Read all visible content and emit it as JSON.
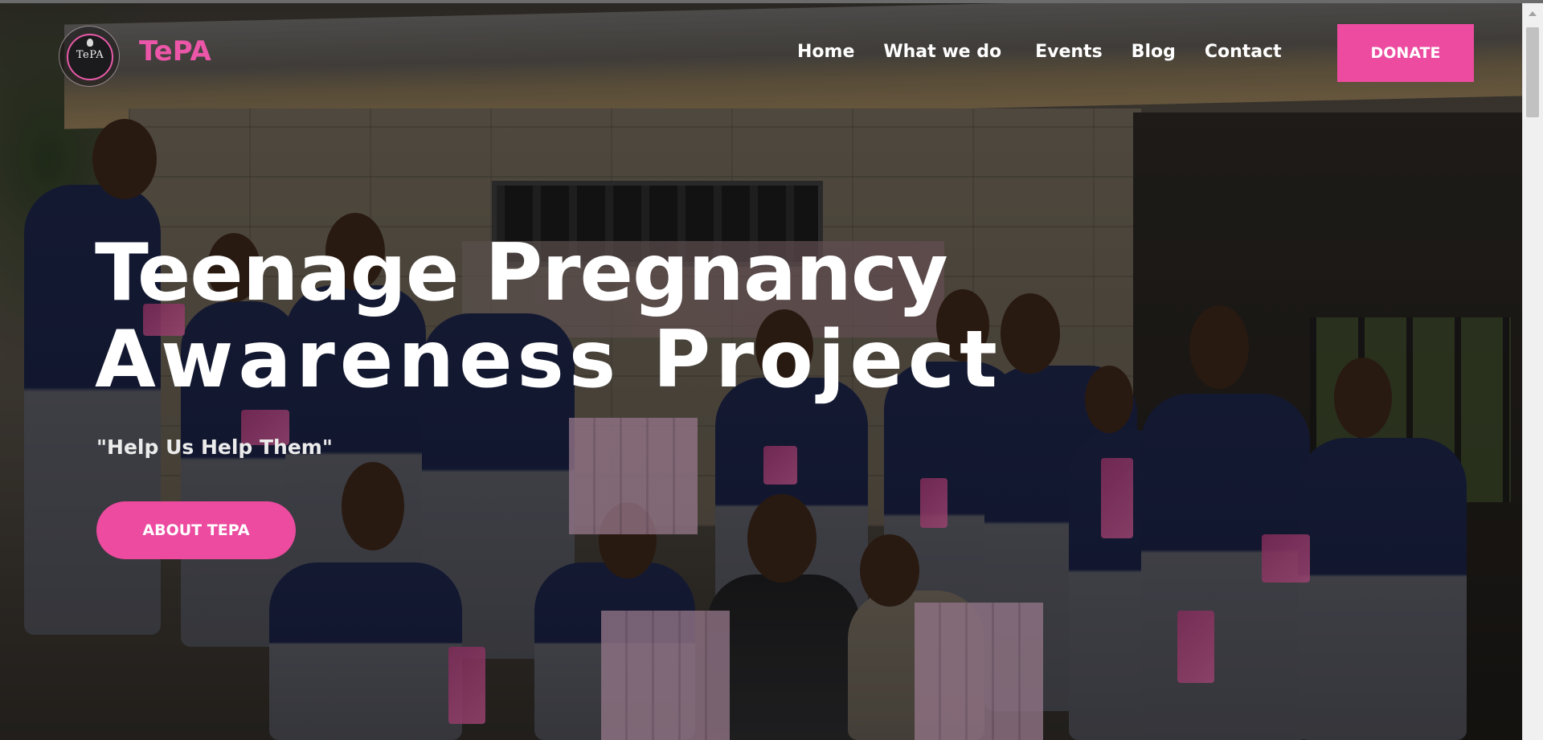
{
  "brand": {
    "logo_text": "TePA",
    "name": "TePA"
  },
  "nav": {
    "items": [
      {
        "label": "Home"
      },
      {
        "label": "What we do"
      },
      {
        "label": "Events"
      },
      {
        "label": "Blog"
      },
      {
        "label": "Contact"
      }
    ],
    "donate_label": "DONATE"
  },
  "hero": {
    "title_line1": "Teenage Pregnancy",
    "title_line2": "Awareness Project",
    "tagline": "\"Help Us Help Them\"",
    "cta_label": "ABOUT TEPA",
    "background_image": "group-photo"
  },
  "colors": {
    "accent": "#ec4ba0",
    "brand_text": "#ec56a8",
    "text": "#ffffff"
  }
}
